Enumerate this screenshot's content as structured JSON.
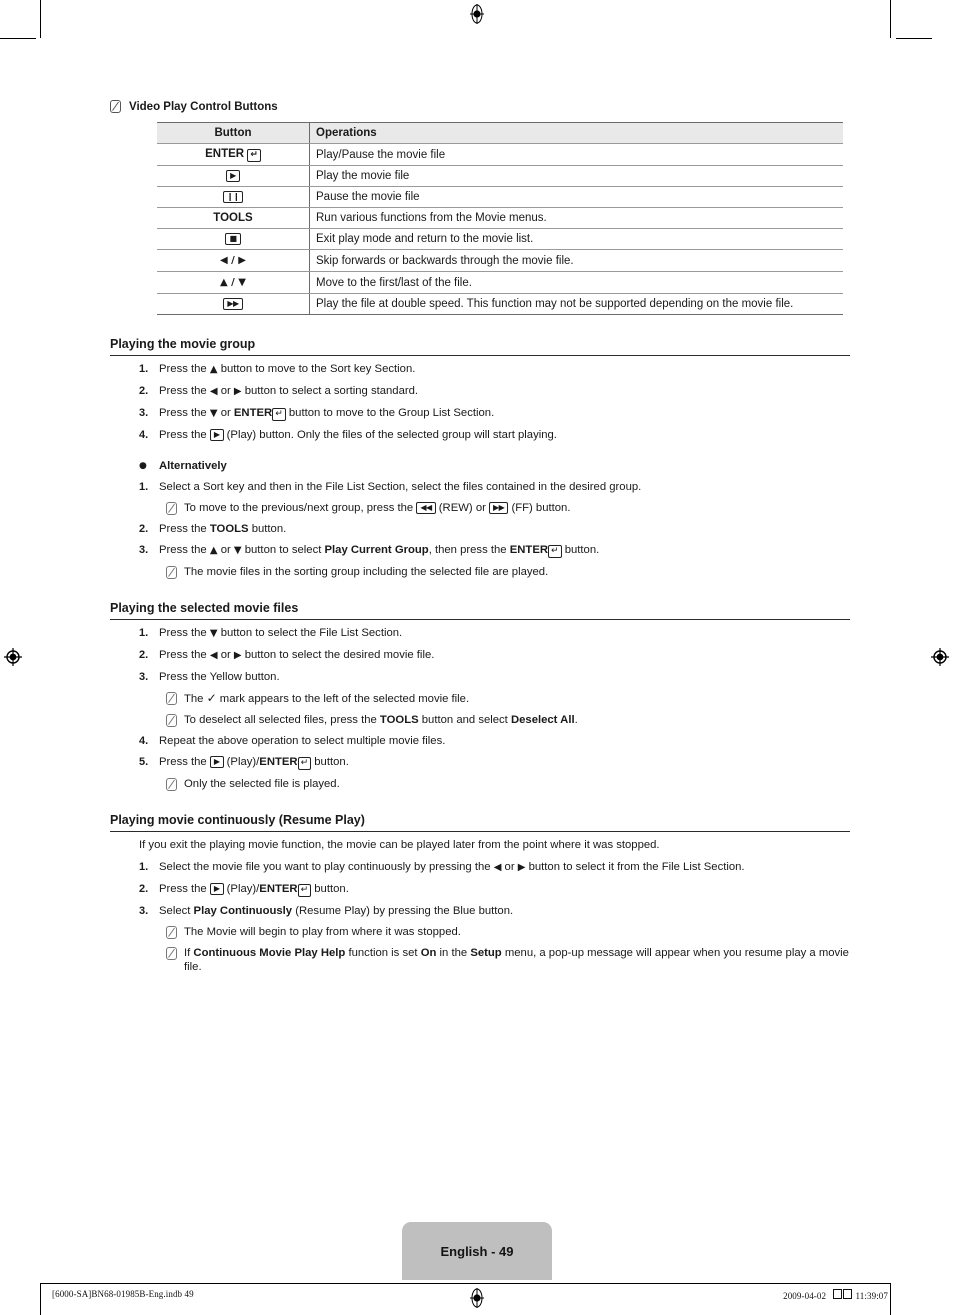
{
  "document": {
    "note_icon_name": "note-pencil-icon",
    "intro_note": "Video Play Control Buttons"
  },
  "table": {
    "headers": [
      "Button",
      "Operations"
    ],
    "rows": [
      {
        "button_text": "ENTER",
        "button_key": "enter",
        "operation": "Play/Pause the movie file"
      },
      {
        "button_text": "",
        "button_key": "play",
        "operation": "Play the movie file"
      },
      {
        "button_text": "",
        "button_key": "pause",
        "operation": "Pause the movie file"
      },
      {
        "button_text": "TOOLS",
        "button_key": "none",
        "operation": "Run various functions from the Movie menus."
      },
      {
        "button_text": "",
        "button_key": "stop",
        "operation": "Exit play mode and return to the movie list."
      },
      {
        "button_text": "◀ / ▶",
        "button_key": "none",
        "operation": "Skip forwards or backwards through the movie file."
      },
      {
        "button_text": "▲ / ▼",
        "button_key": "none",
        "operation": "Move to the first/last of the file."
      },
      {
        "button_text": "",
        "button_key": "ff",
        "operation": "Play the file at double speed. This function may not be supported depending on the movie file."
      }
    ],
    "key_glyphs": {
      "enter": "↵",
      "play": "▶",
      "pause": "❙❙",
      "stop": "■",
      "ff": "▶▶",
      "rew": "◀◀"
    }
  },
  "sections": [
    {
      "heading": "Playing the movie group",
      "steps": [
        {
          "num": "1.",
          "parts": [
            {
              "t": "text",
              "v": "Press the "
            },
            {
              "t": "arrow",
              "v": "▲"
            },
            {
              "t": "text",
              "v": " button to move to the Sort key Section."
            }
          ]
        },
        {
          "num": "2.",
          "parts": [
            {
              "t": "text",
              "v": "Press the "
            },
            {
              "t": "arrow",
              "v": "◀"
            },
            {
              "t": "text",
              "v": " or "
            },
            {
              "t": "arrow",
              "v": "▶"
            },
            {
              "t": "text",
              "v": " button to select a sorting standard."
            }
          ]
        },
        {
          "num": "3.",
          "parts": [
            {
              "t": "text",
              "v": "Press the "
            },
            {
              "t": "arrow",
              "v": "▼"
            },
            {
              "t": "text",
              "v": " or "
            },
            {
              "t": "bold",
              "v": "ENTER"
            },
            {
              "t": "key",
              "v": "enter"
            },
            {
              "t": "text",
              "v": " button to move to the Group List Section."
            }
          ]
        },
        {
          "num": "4.",
          "parts": [
            {
              "t": "text",
              "v": "Press the "
            },
            {
              "t": "key",
              "v": "play"
            },
            {
              "t": "text",
              "v": " (Play) button. Only the files of the selected group will start playing."
            }
          ]
        }
      ],
      "bullet": "Alternatively",
      "alt_steps": [
        {
          "num": "1.",
          "parts": [
            {
              "t": "text",
              "v": "Select a Sort key and then in the File List Section, select the files contained in the desired group."
            }
          ],
          "note": [
            {
              "t": "text",
              "v": "To move to the previous/next group, press the "
            },
            {
              "t": "key",
              "v": "rew"
            },
            {
              "t": "text",
              "v": " (REW) or "
            },
            {
              "t": "key",
              "v": "ff"
            },
            {
              "t": "text",
              "v": " (FF) button."
            }
          ]
        },
        {
          "num": "2.",
          "parts": [
            {
              "t": "text",
              "v": "Press the "
            },
            {
              "t": "bold",
              "v": "TOOLS"
            },
            {
              "t": "text",
              "v": " button."
            }
          ]
        },
        {
          "num": "3.",
          "parts": [
            {
              "t": "text",
              "v": "Press the "
            },
            {
              "t": "arrow",
              "v": "▲"
            },
            {
              "t": "text",
              "v": " or "
            },
            {
              "t": "arrow",
              "v": "▼"
            },
            {
              "t": "text",
              "v": " button to select "
            },
            {
              "t": "bold",
              "v": "Play Current Group"
            },
            {
              "t": "text",
              "v": ", then press the "
            },
            {
              "t": "bold",
              "v": "ENTER"
            },
            {
              "t": "key",
              "v": "enter"
            },
            {
              "t": "text",
              "v": " button."
            }
          ],
          "note": [
            {
              "t": "text",
              "v": "The movie files in the sorting group including the selected file are played."
            }
          ]
        }
      ]
    },
    {
      "heading": "Playing the selected movie files",
      "steps": [
        {
          "num": "1.",
          "parts": [
            {
              "t": "text",
              "v": "Press the "
            },
            {
              "t": "arrow",
              "v": "▼"
            },
            {
              "t": "text",
              "v": " button to select the File List Section."
            }
          ]
        },
        {
          "num": "2.",
          "parts": [
            {
              "t": "text",
              "v": "Press the "
            },
            {
              "t": "arrow",
              "v": "◀"
            },
            {
              "t": "text",
              "v": " or "
            },
            {
              "t": "arrow",
              "v": "▶"
            },
            {
              "t": "text",
              "v": " button to select the desired movie file."
            }
          ]
        },
        {
          "num": "3.",
          "parts": [
            {
              "t": "text",
              "v": "Press the Yellow button."
            }
          ],
          "notes": [
            [
              {
                "t": "text",
                "v": "The "
              },
              {
                "t": "check",
                "v": "✓"
              },
              {
                "t": "text",
                "v": " mark appears to the left of the selected movie file."
              }
            ],
            [
              {
                "t": "text",
                "v": "To deselect all selected files, press the "
              },
              {
                "t": "bold",
                "v": "TOOLS"
              },
              {
                "t": "text",
                "v": " button and select "
              },
              {
                "t": "bold",
                "v": "Deselect All"
              },
              {
                "t": "text",
                "v": "."
              }
            ]
          ]
        },
        {
          "num": "4.",
          "parts": [
            {
              "t": "text",
              "v": "Repeat the above operation to select multiple movie files."
            }
          ]
        },
        {
          "num": "5.",
          "parts": [
            {
              "t": "text",
              "v": "Press the "
            },
            {
              "t": "key",
              "v": "play"
            },
            {
              "t": "text",
              "v": " (Play)/"
            },
            {
              "t": "bold",
              "v": "ENTER"
            },
            {
              "t": "key",
              "v": "enter"
            },
            {
              "t": "text",
              "v": " button."
            }
          ],
          "notes": [
            [
              {
                "t": "text",
                "v": "Only the selected file is played."
              }
            ]
          ]
        }
      ]
    },
    {
      "heading": "Playing movie continuously (Resume Play)",
      "intro": "If you exit the playing movie function, the movie can be played later from the point where it was stopped.",
      "steps": [
        {
          "num": "1.",
          "parts": [
            {
              "t": "text",
              "v": "Select the movie file you want to play continuously by pressing the "
            },
            {
              "t": "arrow",
              "v": "◀"
            },
            {
              "t": "text",
              "v": " or "
            },
            {
              "t": "arrow",
              "v": "▶"
            },
            {
              "t": "text",
              "v": " button to select it from the File List Section."
            }
          ]
        },
        {
          "num": "2.",
          "parts": [
            {
              "t": "text",
              "v": "Press the "
            },
            {
              "t": "key",
              "v": "play"
            },
            {
              "t": "text",
              "v": " (Play)/"
            },
            {
              "t": "bold",
              "v": "ENTER"
            },
            {
              "t": "key",
              "v": "enter"
            },
            {
              "t": "text",
              "v": " button."
            }
          ]
        },
        {
          "num": "3.",
          "parts": [
            {
              "t": "text",
              "v": "Select "
            },
            {
              "t": "bold",
              "v": "Play Continuously"
            },
            {
              "t": "text",
              "v": " (Resume Play) by pressing the Blue button."
            }
          ],
          "notes": [
            [
              {
                "t": "text",
                "v": "The Movie will begin to play from where it was stopped."
              }
            ],
            [
              {
                "t": "text",
                "v": "If "
              },
              {
                "t": "bold",
                "v": "Continuous Movie Play Help"
              },
              {
                "t": "text",
                "v": " function is set "
              },
              {
                "t": "bold",
                "v": "On"
              },
              {
                "t": "text",
                "v": " in the "
              },
              {
                "t": "bold",
                "v": "Setup"
              },
              {
                "t": "text",
                "v": " menu, a pop-up message will appear when you resume play a movie file."
              }
            ]
          ]
        }
      ]
    }
  ],
  "footer": {
    "page_label": "English - 49",
    "file_info": "[6000-SA]BN68-01985B-Eng.indb   49",
    "date": "2009-04-02",
    "time": "11:39:07"
  }
}
